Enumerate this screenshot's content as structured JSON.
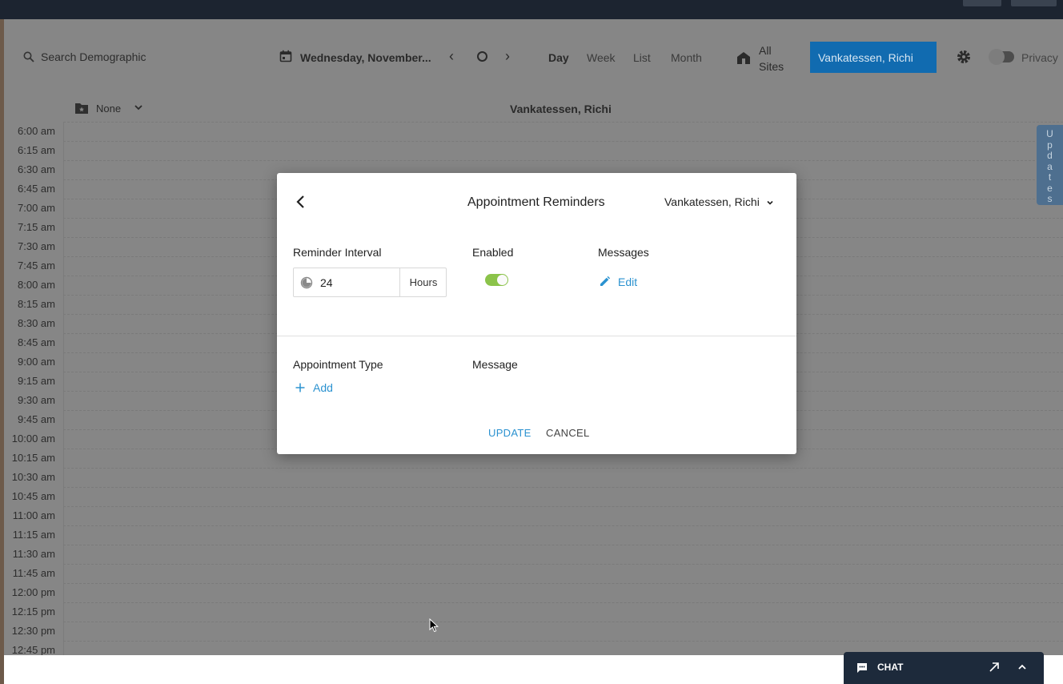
{
  "search": {
    "placeholder": "Search Demographic"
  },
  "date_label": "Wednesday, November...",
  "views": {
    "day": "Day",
    "week": "Week",
    "list": "List",
    "month": "Month"
  },
  "sites": {
    "line1": "All",
    "line2": "Sites"
  },
  "provider_button": "Vankatessen, Richi",
  "privacy_label": "Privacy",
  "filter_label": "None",
  "column_header": "Vankatessen, Richi",
  "updates_tab": "U p d a t e s",
  "time_slots": [
    "6:00 am",
    "6:15 am",
    "6:30 am",
    "6:45 am",
    "7:00 am",
    "7:15 am",
    "7:30 am",
    "7:45 am",
    "8:00 am",
    "8:15 am",
    "8:30 am",
    "8:45 am",
    "9:00 am",
    "9:15 am",
    "9:30 am",
    "9:45 am",
    "10:00 am",
    "10:15 am",
    "10:30 am",
    "10:45 am",
    "11:00 am",
    "11:15 am",
    "11:30 am",
    "11:45 am",
    "12:00 pm",
    "12:15 pm",
    "12:30 pm",
    "12:45 pm"
  ],
  "modal": {
    "title": "Appointment Reminders",
    "provider": "Vankatessen, Richi",
    "reminder_interval_label": "Reminder Interval",
    "interval_value": "24",
    "interval_unit": "Hours",
    "enabled_label": "Enabled",
    "enabled": true,
    "messages_label": "Messages",
    "edit_label": "Edit",
    "appointment_type_label": "Appointment Type",
    "message_label": "Message",
    "add_label": "Add",
    "update_label": "UPDATE",
    "cancel_label": "CANCEL"
  },
  "chat": {
    "label": "CHAT"
  },
  "colors": {
    "primary": "#116bb0",
    "link": "#2b92d0",
    "toggle_on": "#8bc34a",
    "chat_bg": "#1d2a3b"
  }
}
